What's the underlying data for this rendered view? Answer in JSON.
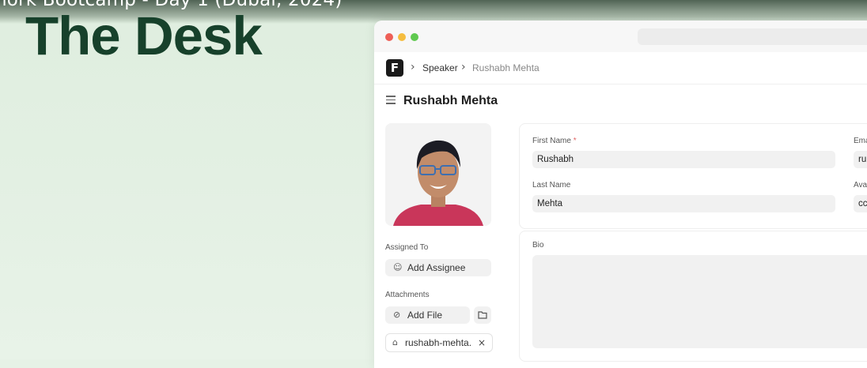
{
  "video": {
    "title": "nork Bootcamp - Day 1 (Dubai, 2024)"
  },
  "slide": {
    "heading": "The Desk"
  },
  "app": {
    "logo_letter": "F",
    "breadcrumbs": [
      {
        "label": "Speaker"
      },
      {
        "label": "Rushabh Mehta"
      }
    ],
    "doc_title": "Rushabh Mehta",
    "sidebar": {
      "assigned_to_label": "Assigned To",
      "add_assignee_label": "Add Assignee",
      "attachments_label": "Attachments",
      "add_file_label": "Add File",
      "attachment_file_name": "rushabh-mehta.",
      "remove_symbol": "×"
    },
    "form": {
      "first_name_label": "First Name",
      "required_marker": "*",
      "first_name_value": "Rushabh",
      "last_name_label": "Last Name",
      "last_name_value": "Mehta",
      "email_label": "Ema",
      "email_value": "ru",
      "avatar_label": "Ava",
      "avatar_value": "cc",
      "bio_label": "Bio",
      "bio_value": ""
    }
  },
  "colors": {
    "slide_background": "#e3f0e3",
    "heading": "#17412b",
    "window_red": "#ee5f57",
    "window_yellow": "#f5bd3f",
    "window_green": "#5fc94f"
  }
}
